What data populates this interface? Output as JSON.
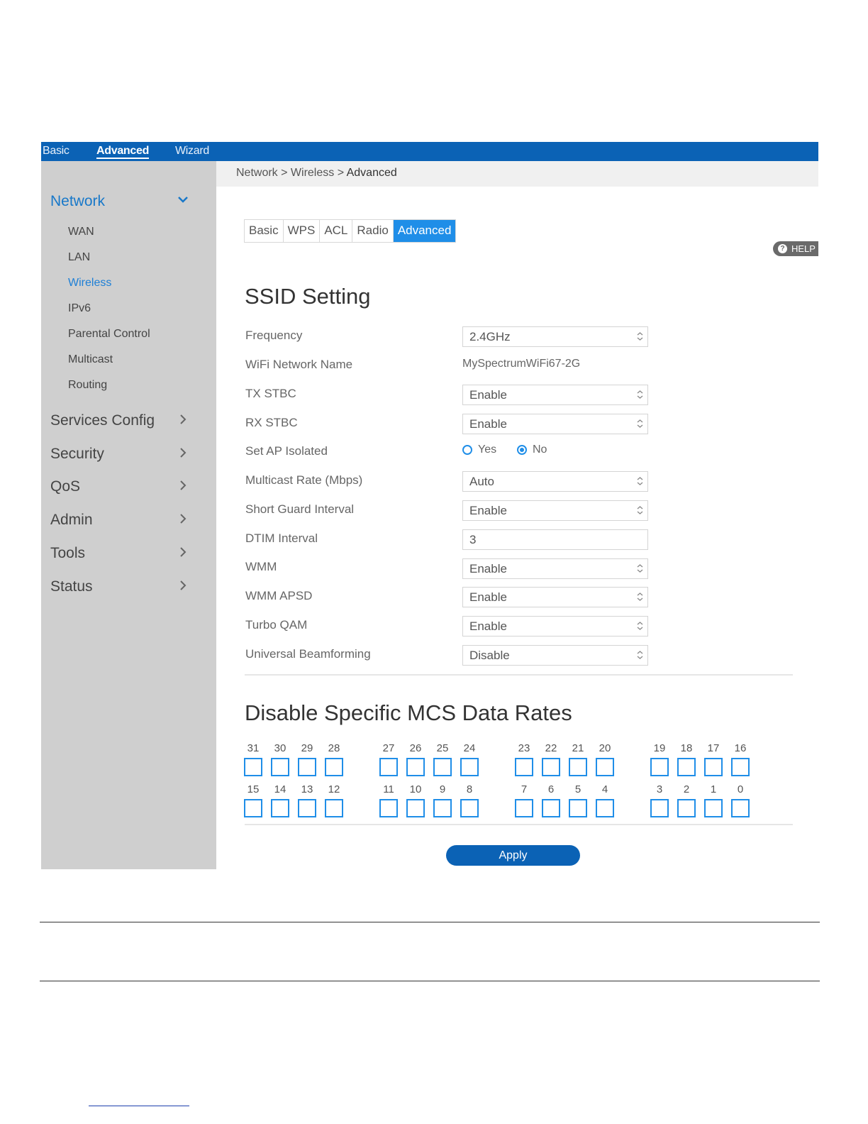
{
  "topnav": {
    "basic": "Basic",
    "advanced": "Advanced",
    "wizard": "Wizard"
  },
  "sidebar": {
    "network": {
      "label": "Network",
      "items": [
        "WAN",
        "LAN",
        "Wireless",
        "IPv6",
        "Parental Control",
        "Multicast",
        "Routing"
      ],
      "active_item": "Wireless"
    },
    "groups": [
      "Services Config",
      "Security",
      "QoS",
      "Admin",
      "Tools",
      "Status"
    ]
  },
  "breadcrumb": {
    "path": "Network > Wireless > ",
    "current": "Advanced"
  },
  "tabs": [
    "Basic",
    "WPS",
    "ACL",
    "Radio",
    "Advanced"
  ],
  "active_tab": "Advanced",
  "help_label": "HELP",
  "ssid": {
    "title": "SSID Setting",
    "frequency": {
      "label": "Frequency",
      "value": "2.4GHz"
    },
    "network_name": {
      "label": "WiFi Network Name",
      "value": "MySpectrumWiFi67-2G"
    },
    "tx_stbc": {
      "label": "TX STBC",
      "value": "Enable"
    },
    "rx_stbc": {
      "label": "RX STBC",
      "value": "Enable"
    },
    "ap_isolated": {
      "label": "Set AP Isolated",
      "yes": "Yes",
      "no": "No",
      "selected": "No"
    },
    "multicast_rate": {
      "label": "Multicast Rate (Mbps)",
      "value": "Auto"
    },
    "short_guard": {
      "label": "Short Guard Interval",
      "value": "Enable"
    },
    "dtim": {
      "label": "DTIM Interval",
      "value": "3"
    },
    "wmm": {
      "label": "WMM",
      "value": "Enable"
    },
    "wmm_apsd": {
      "label": "WMM APSD",
      "value": "Enable"
    },
    "turbo_qam": {
      "label": "Turbo QAM",
      "value": "Enable"
    },
    "beamforming": {
      "label": "Universal Beamforming",
      "value": "Disable"
    }
  },
  "mcs": {
    "title": "Disable Specific MCS Data Rates",
    "row1": [
      "31",
      "30",
      "29",
      "28",
      "27",
      "26",
      "25",
      "24",
      "23",
      "22",
      "21",
      "20",
      "19",
      "18",
      "17",
      "16"
    ],
    "row2": [
      "15",
      "14",
      "13",
      "12",
      "11",
      "10",
      "9",
      "8",
      "7",
      "6",
      "5",
      "4",
      "3",
      "2",
      "1",
      "0"
    ]
  },
  "apply_label": "Apply",
  "colors": {
    "topbar": "#0b62b5",
    "accent": "#1f8ee8",
    "sidebar": "#cfcfcf"
  }
}
